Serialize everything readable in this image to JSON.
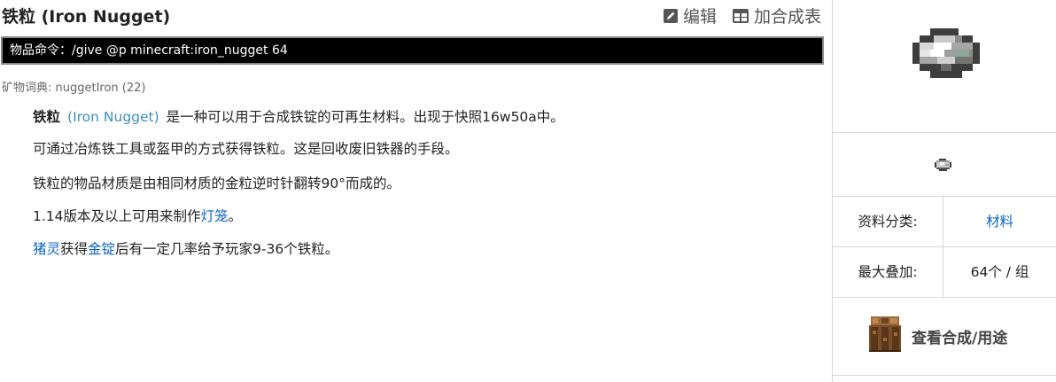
{
  "title": "铁粒 (Iron Nugget)",
  "actions": {
    "edit_label": "编辑",
    "edit_icon": "pencil-icon",
    "add_recipe_label": "加合成表",
    "add_recipe_icon": "table-icon"
  },
  "command": {
    "text": "物品命令：/give @p minecraft:iron_nugget 64"
  },
  "ore_dict": {
    "text": "矿物词典: nuggetIron (22)"
  },
  "paragraphs": {
    "p1": {
      "name_cn": "铁粒",
      "name_en": "(Iron Nugget)",
      "rest": "是一种可以用于合成铁锭的可再生材料。出现于快照16w50a中。"
    },
    "p2": "可通过冶炼铁工具或盔甲的方式获得铁粒。这是回收废旧铁器的手段。",
    "p3": "铁粒的物品材质是由相同材质的金粒逆时针翻转90°而成的。",
    "p4": {
      "before": "1.14版本及以上可用来制作",
      "link": "灯笼",
      "after": "。"
    },
    "p5": {
      "link1": "猪灵",
      "mid1": "获得",
      "link2": "金锭",
      "rest": "后有一定几率给予玩家9-36个铁粒。"
    }
  },
  "infobox": {
    "image_icon": "iron-nugget-icon",
    "rows": [
      {
        "label": "资料分类:",
        "value": "材料",
        "is_link": true
      },
      {
        "label": "最大叠加:",
        "value": "64个 / 组",
        "is_link": false
      }
    ],
    "recipe_label": "查看合成/用途",
    "recipe_icon": "crafting-table-icon"
  },
  "colors": {
    "link": "#0b64c8",
    "english_name": "#3f8fbf",
    "command_bg": "#000000",
    "border": "#d8d8d8"
  }
}
